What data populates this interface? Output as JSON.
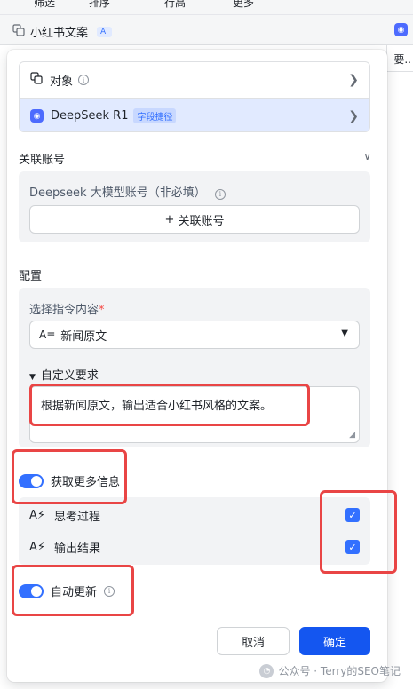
{
  "toolbar": {
    "items": [
      "筛选",
      "排序",
      "行高",
      "更多"
    ]
  },
  "field_header": {
    "name": "小红书文案",
    "ai_badge": "AI"
  },
  "cell_snippet": "要..",
  "source": {
    "object_label": "对象",
    "model_label": "DeepSeek R1",
    "model_tag": "字段捷径"
  },
  "linked_account": {
    "title": "关联账号",
    "account_label": "Deepseek 大模型账号（非必填）",
    "button_label": "关联账号",
    "plus": "+"
  },
  "config": {
    "title": "配置",
    "instruction_label": "选择指令内容",
    "required_mark": "*",
    "instruction_value": "新闻原文",
    "custom_req_label": "自定义要求",
    "custom_req_text": "根据新闻原文，输出适合小红书风格的文案。"
  },
  "more_info": {
    "label": "获取更多信息",
    "enabled": true,
    "items": [
      {
        "label": "思考过程",
        "checked": true
      },
      {
        "label": "输出结果",
        "checked": true
      }
    ]
  },
  "auto_update": {
    "label": "自动更新",
    "enabled": true
  },
  "buttons": {
    "cancel": "取消",
    "confirm": "确定"
  },
  "watermark": "公众号 · Terry的SEO笔记",
  "colors": {
    "accent": "#3370ff",
    "primary_button": "#1456f0",
    "highlight": "#e94545"
  }
}
